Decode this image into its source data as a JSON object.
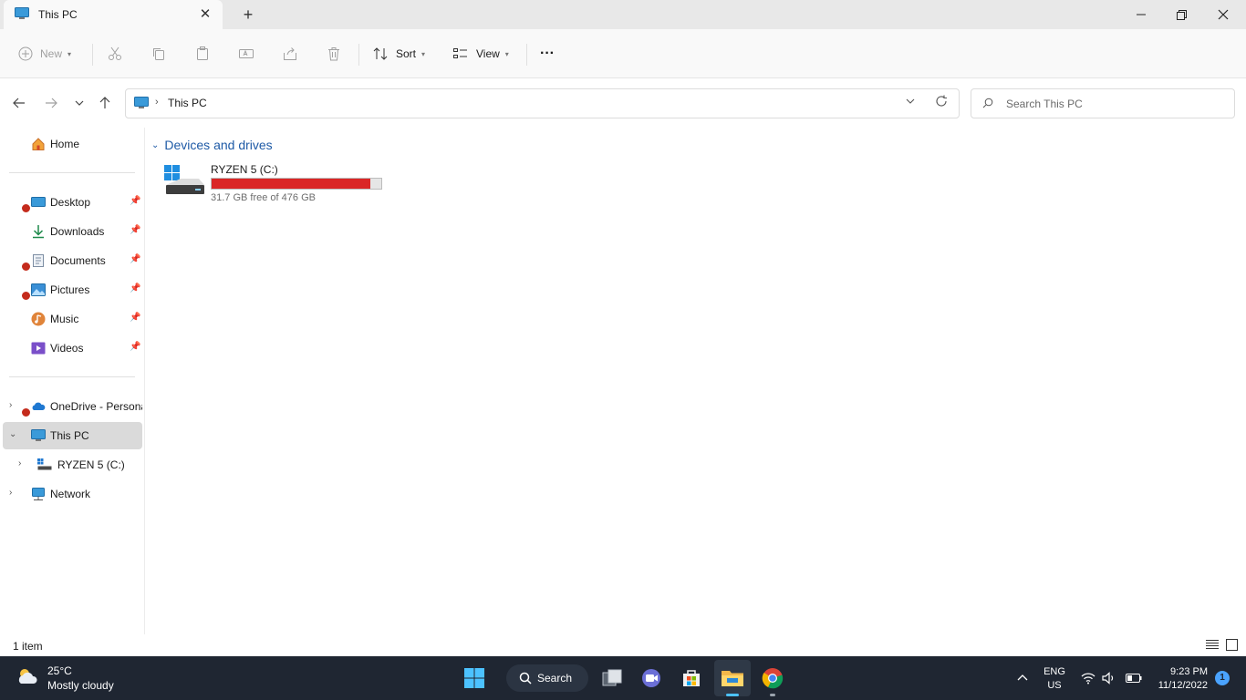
{
  "window": {
    "tab_title": "This PC",
    "tab_icon": "this-pc-icon"
  },
  "toolbar": {
    "new_label": "New",
    "sort_label": "Sort",
    "view_label": "View",
    "more_label": "···"
  },
  "address": {
    "path": "This PC",
    "separator": "›"
  },
  "search": {
    "placeholder": "Search This PC"
  },
  "sidebar": {
    "home": "Home",
    "quick_access": [
      {
        "label": "Desktop",
        "icon": "desktop-icon",
        "pinned": true,
        "error_badge": true
      },
      {
        "label": "Downloads",
        "icon": "downloads-icon",
        "pinned": true,
        "error_badge": false
      },
      {
        "label": "Documents",
        "icon": "documents-icon",
        "pinned": true,
        "error_badge": true
      },
      {
        "label": "Pictures",
        "icon": "pictures-icon",
        "pinned": true,
        "error_badge": true
      },
      {
        "label": "Music",
        "icon": "music-icon",
        "pinned": true,
        "error_badge": false
      },
      {
        "label": "Videos",
        "icon": "videos-icon",
        "pinned": true,
        "error_badge": false
      }
    ],
    "tree": {
      "onedrive": "OneDrive - Persona",
      "this_pc": "This PC",
      "drive_c": "RYZEN 5 (C:)",
      "network": "Network"
    }
  },
  "content": {
    "group_header": "Devices and drives",
    "drives": [
      {
        "name": "RYZEN 5 (C:)",
        "free_text": "31.7 GB free of 476 GB",
        "used_fraction": 0.933,
        "bar_color": "#da2626"
      }
    ]
  },
  "status": {
    "item_count": "1 item"
  },
  "taskbar": {
    "weather_temp": "25°C",
    "weather_desc": "Mostly cloudy",
    "search_label": "Search",
    "lang_line1": "ENG",
    "lang_line2": "US",
    "time": "9:23 PM",
    "date": "11/12/2022",
    "notification_count": "1"
  },
  "colors": {
    "accent": "#1e5aa6",
    "taskbar_bg": "#1f2632",
    "drive_bar": "#da2626"
  }
}
